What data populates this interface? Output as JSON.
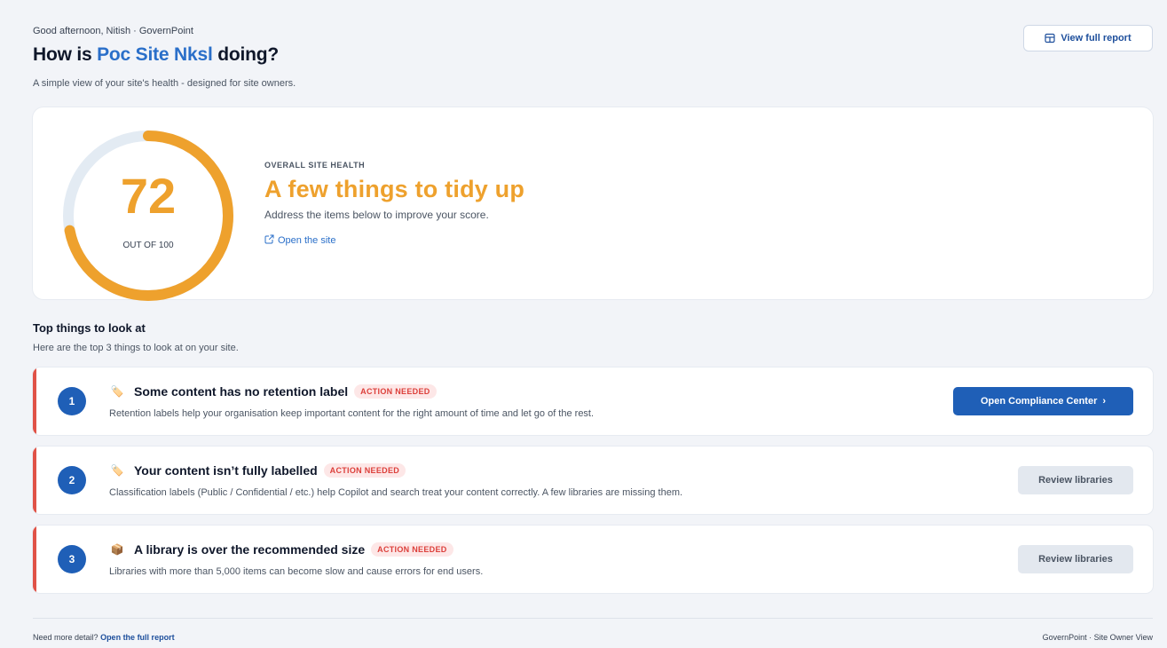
{
  "header": {
    "greeting": "Good afternoon, Nitish · GovernPoint",
    "title_prefix": "How is ",
    "site_name": "Poc Site Nksl",
    "title_suffix": " doing?",
    "subtitle": "A simple view of your site's health - designed for site owners.",
    "view_report_label": "View full report"
  },
  "health": {
    "score": "72",
    "score_fraction": 0.72,
    "out_of": "OUT OF 100",
    "eyebrow": "OVERALL SITE HEALTH",
    "headline": "A few things to tidy up",
    "description": "Address the items below to improve your score.",
    "open_site_label": "Open the site",
    "accent_color": "#eea12d"
  },
  "top_things": {
    "title": "Top things to look at",
    "subtitle": "Here are the top 3 things to look at on your site.",
    "items": [
      {
        "number": "1",
        "icon": "tag-icon",
        "emoji": "🏷️",
        "title": "Some content has no retention label",
        "badge": "ACTION NEEDED",
        "description": "Retention labels help your organisation keep important content for the right amount of time and let go of the rest.",
        "action_label": "Open Compliance Center",
        "action_chevron": "›"
      },
      {
        "number": "2",
        "icon": "tag-icon",
        "emoji": "🏷️",
        "title": "Your content isn’t fully labelled",
        "badge": "ACTION NEEDED",
        "description": "Classification labels (Public / Confidential / etc.) help Copilot and search treat your content correctly. A few libraries are missing them.",
        "action_label": "Review libraries"
      },
      {
        "number": "3",
        "icon": "package-icon",
        "emoji": "📦",
        "title": "A library is over the recommended size",
        "badge": "ACTION NEEDED",
        "description": "Libraries with more than 5,000 items can become slow and cause errors for end users.",
        "action_label": "Review libraries"
      }
    ]
  },
  "footer": {
    "prefix": "Need more detail?",
    "link_label": "Open the full report",
    "right": "GovernPoint · Site Owner View"
  },
  "colors": {
    "brand_blue": "#1f5fb7",
    "link_blue": "#2a6fc9",
    "warning_orange": "#eea12d",
    "danger_red": "#e05247"
  }
}
